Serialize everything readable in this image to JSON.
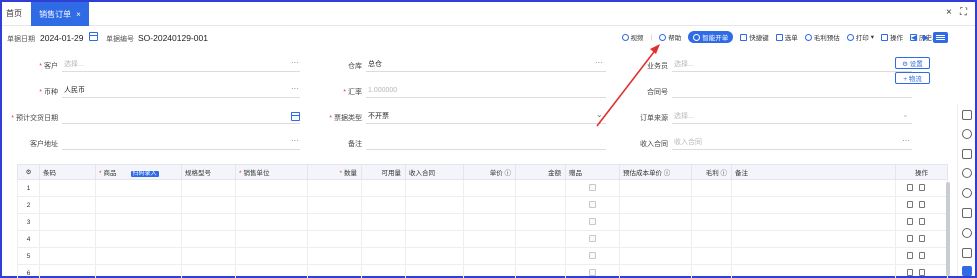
{
  "tabs": {
    "home": "首页",
    "active": "销售订单",
    "active_close": "×"
  },
  "window": {
    "close": "×",
    "fullscreen": "⛶"
  },
  "toolbar": {
    "date_label": "单据日期",
    "date_value": "2024-01-29",
    "code_label": "单据编号",
    "code_value": "SO-20240129-001",
    "actions": {
      "view": "视频",
      "help": "帮助",
      "smart": "智能开单",
      "shortcut": "快捷键",
      "select": "选单",
      "profit": "毛利预估",
      "print": "打印",
      "operate": "操作",
      "history": "历史单据"
    },
    "prev": "◀",
    "next": "▶"
  },
  "form": {
    "customer": {
      "label": "客户",
      "placeholder": "选择..."
    },
    "warehouse": {
      "label": "仓库",
      "value": "总仓"
    },
    "salesman": {
      "label": "业务员",
      "placeholder": "选择..."
    },
    "currency": {
      "label": "币种",
      "value": "人民币"
    },
    "rate": {
      "label": "汇率",
      "value": "1.000000"
    },
    "contract_no": {
      "label": "合同号"
    },
    "delivery_date": {
      "label": "预计交货日期"
    },
    "invoice_type": {
      "label": "票据类型",
      "value": "不开票"
    },
    "order_source": {
      "label": "订单来源",
      "placeholder": "选择..."
    },
    "customer_address": {
      "label": "客户地址"
    },
    "remark": {
      "label": "备注"
    },
    "income_contract": {
      "label": "收入合同",
      "placeholder": "收入合同"
    },
    "ellipsis": "···"
  },
  "side_buttons": {
    "settings": "⚙ 设置",
    "add_item": "+ 物流"
  },
  "table": {
    "headers": {
      "settings": "⚙",
      "barcode": "条码",
      "product": "商品",
      "scan": "扫码录入",
      "spec": "规格型号",
      "unit": "销售单位",
      "qty": "数量",
      "available": "可用量",
      "income_contract": "收入合同",
      "price": "单价 ⓘ",
      "amount": "金额",
      "gift": "赠品",
      "est_cost": "预估成本单价 ⓘ",
      "profit": "毛利 ⓘ",
      "remark": "备注",
      "operate": "操作"
    },
    "rows": [
      "1",
      "2",
      "3",
      "4",
      "5",
      "6"
    ]
  },
  "colors": {
    "primary": "#2f6be5",
    "arrow": "#e03131",
    "frame": "#2f3fd6"
  }
}
